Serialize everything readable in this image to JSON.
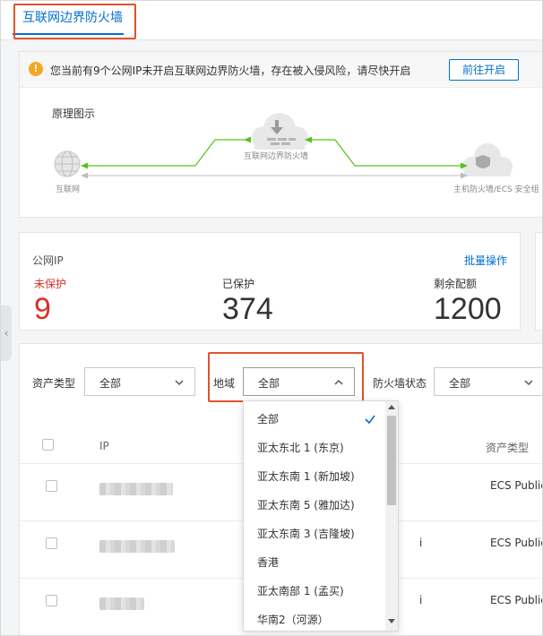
{
  "tab": {
    "label": "互联网边界防火墙"
  },
  "notice": {
    "text": "您当前有9个公网IP未开启互联网边界防火墙，存在被入侵风险，请尽快开启",
    "button": "前往开启"
  },
  "diagram": {
    "title": "原理图示",
    "internet_label": "互联网",
    "firewall_label": "互联网边界防火墙",
    "host_label": "主机防火墙/ECS 安全组"
  },
  "stats": {
    "title": "公网IP",
    "batch_link": "批量操作",
    "unprotected": {
      "label": "未保护",
      "value": "9"
    },
    "protected": {
      "label": "已保护",
      "value": "374"
    },
    "quota": {
      "label": "剩余配额",
      "value": "1200"
    }
  },
  "filters": {
    "asset_type": {
      "label": "资产类型",
      "value": "全部"
    },
    "region": {
      "label": "地域",
      "value": "全部"
    },
    "firewall_status": {
      "label": "防火墙状态",
      "value": "全部"
    }
  },
  "table": {
    "headers": {
      "ip": "IP",
      "asset_type": "资产类型"
    },
    "rows": [
      {
        "asset_type": "ECS Public"
      },
      {
        "asset_type": "ECS Public"
      },
      {
        "asset_type": "ECS Public"
      }
    ]
  },
  "region_dropdown": {
    "selected_index": 0,
    "options": [
      "全部",
      "亚太东北 1 (东京)",
      "亚太东南 1 (新加坡)",
      "亚太东南 5 (雅加达)",
      "亚太东南 3 (吉隆坡)",
      "香港",
      "亚太南部 1 (孟买)",
      "华南2（河源）"
    ]
  },
  "colors": {
    "accent": "#0070cc",
    "danger": "#d93026",
    "warning": "#f5a623",
    "highlight_box": "#e0532b",
    "flow_green": "#52c41a"
  }
}
